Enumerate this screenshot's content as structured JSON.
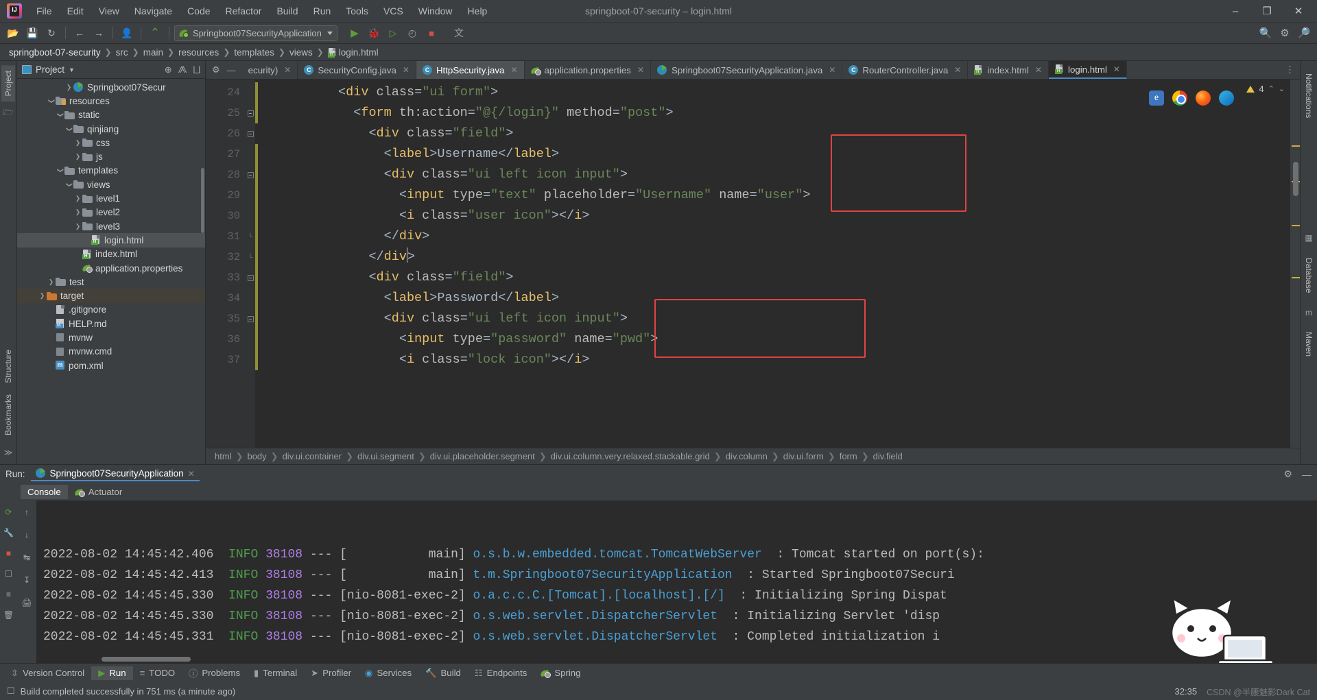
{
  "window": {
    "title": "springboot-07-security – login.html",
    "minimize": "–",
    "maximize": "❐",
    "close": "✕"
  },
  "menu": [
    {
      "label": "File"
    },
    {
      "label": "Edit"
    },
    {
      "label": "View"
    },
    {
      "label": "Navigate"
    },
    {
      "label": "Code"
    },
    {
      "label": "Refactor"
    },
    {
      "label": "Build"
    },
    {
      "label": "Run"
    },
    {
      "label": "Tools"
    },
    {
      "label": "VCS"
    },
    {
      "label": "Window"
    },
    {
      "label": "Help"
    }
  ],
  "toolbar": {
    "open_icon": "📂",
    "save_icon": "💾",
    "sync_icon": "↻",
    "back_icon": "←",
    "forward_icon": "→",
    "profile_icon": "👤",
    "updates_icon": "⌃",
    "run_config": "Springboot07SecurityApplication",
    "run_icon": "▶",
    "debug_icon": "🐞",
    "run_coverage_icon": "▷",
    "profiler_icon": "◴",
    "stop_icon": "■",
    "translate_icon": "文",
    "search_icon": "🔍",
    "settings_icon": "⚙",
    "search_everywhere": "🔎"
  },
  "breadcrumb": {
    "items": [
      "springboot-07-security",
      "src",
      "main",
      "resources",
      "templates",
      "views"
    ],
    "file": "login.html"
  },
  "left_rail": {
    "project_tab": "Project",
    "structure_tab": "Structure",
    "bookmarks_tab": "Bookmarks",
    "more": "≫"
  },
  "project_panel": {
    "title": "Project",
    "dropdown_caret": "▼",
    "locate_icon": "⊕",
    "expand_icon": "⨇",
    "collapse_icon": "⨆",
    "settings_icon": "⚙",
    "hide_icon": "—",
    "tree": [
      {
        "label": "Springboot07Secur",
        "indent": 5,
        "arrow": "closed",
        "icon": "spring",
        "selected": false
      },
      {
        "label": "resources",
        "indent": 3,
        "arrow": "open",
        "icon": "folder-res",
        "selected": false
      },
      {
        "label": "static",
        "indent": 4,
        "arrow": "open",
        "icon": "folder",
        "selected": false
      },
      {
        "label": "qinjiang",
        "indent": 5,
        "arrow": "open",
        "icon": "folder",
        "selected": false
      },
      {
        "label": "css",
        "indent": 6,
        "arrow": "closed",
        "icon": "folder",
        "selected": false
      },
      {
        "label": "js",
        "indent": 6,
        "arrow": "closed",
        "icon": "folder",
        "selected": false
      },
      {
        "label": "templates",
        "indent": 4,
        "arrow": "open",
        "icon": "folder",
        "selected": false
      },
      {
        "label": "views",
        "indent": 5,
        "arrow": "open",
        "icon": "folder",
        "selected": false
      },
      {
        "label": "level1",
        "indent": 6,
        "arrow": "closed",
        "icon": "folder",
        "selected": false
      },
      {
        "label": "level2",
        "indent": 6,
        "arrow": "closed",
        "icon": "folder",
        "selected": false
      },
      {
        "label": "level3",
        "indent": 6,
        "arrow": "closed",
        "icon": "folder",
        "selected": false
      },
      {
        "label": "login.html",
        "indent": 7,
        "arrow": "none",
        "icon": "html",
        "selected": true
      },
      {
        "label": "index.html",
        "indent": 6,
        "arrow": "none",
        "icon": "html",
        "selected": false
      },
      {
        "label": "application.properties",
        "indent": 6,
        "arrow": "none",
        "icon": "leaf",
        "selected": false
      },
      {
        "label": "test",
        "indent": 3,
        "arrow": "closed",
        "icon": "folder",
        "selected": false
      },
      {
        "label": "target",
        "indent": 2,
        "arrow": "closed",
        "icon": "folder-orange",
        "selected": false,
        "secondary": true
      },
      {
        "label": ".gitignore",
        "indent": 3,
        "arrow": "none",
        "icon": "gitignore",
        "selected": false
      },
      {
        "label": "HELP.md",
        "indent": 3,
        "arrow": "none",
        "icon": "md",
        "selected": false
      },
      {
        "label": "mvnw",
        "indent": 3,
        "arrow": "none",
        "icon": "sh",
        "selected": false
      },
      {
        "label": "mvnw.cmd",
        "indent": 3,
        "arrow": "none",
        "icon": "sh",
        "selected": false
      },
      {
        "label": "pom.xml",
        "indent": 3,
        "arrow": "none",
        "icon": "maven",
        "selected": false
      }
    ]
  },
  "editor_tabs": [
    {
      "label": "ecurity)",
      "icon": "none",
      "state": "partial"
    },
    {
      "label": "SecurityConfig.java",
      "icon": "class",
      "state": "normal"
    },
    {
      "label": "HttpSecurity.java",
      "icon": "class",
      "state": "active"
    },
    {
      "label": "application.properties",
      "icon": "leaf",
      "state": "normal"
    },
    {
      "label": "Springboot07SecurityApplication.java",
      "icon": "spring",
      "state": "normal"
    },
    {
      "label": "RouterController.java",
      "icon": "class",
      "state": "normal"
    },
    {
      "label": "index.html",
      "icon": "html",
      "state": "normal"
    },
    {
      "label": "login.html",
      "icon": "html",
      "state": "current"
    }
  ],
  "editor": {
    "close_glyph": "✕",
    "inspections": {
      "count": "4",
      "icon": "warning-triangle"
    },
    "up_icon": "⌃",
    "down_icon": "⌄",
    "lines": [
      {
        "num": "24",
        "fold": "none",
        "tokens": [
          {
            "t": "          ",
            "c": "plain"
          },
          {
            "t": "<",
            "c": "brk"
          },
          {
            "t": "div",
            "c": "tag"
          },
          {
            "t": " class",
            "c": "attr"
          },
          {
            "t": "=",
            "c": "brk"
          },
          {
            "t": "\"ui form\"",
            "c": "str"
          },
          {
            "t": ">",
            "c": "brk"
          }
        ]
      },
      {
        "num": "25",
        "fold": "open",
        "tokens": [
          {
            "t": "            ",
            "c": "plain"
          },
          {
            "t": "<",
            "c": "brk"
          },
          {
            "t": "form",
            "c": "tag"
          },
          {
            "t": " th:action",
            "c": "attr"
          },
          {
            "t": "=",
            "c": "brk"
          },
          {
            "t": "\"@{/login}\"",
            "c": "str"
          },
          {
            "t": " method",
            "c": "attr"
          },
          {
            "t": "=",
            "c": "brk"
          },
          {
            "t": "\"post\"",
            "c": "str"
          },
          {
            "t": ">",
            "c": "brk"
          }
        ]
      },
      {
        "num": "26",
        "fold": "open",
        "tokens": [
          {
            "t": "              ",
            "c": "plain"
          },
          {
            "t": "<",
            "c": "brk"
          },
          {
            "t": "div",
            "c": "tag"
          },
          {
            "t": " class",
            "c": "attr"
          },
          {
            "t": "=",
            "c": "brk"
          },
          {
            "t": "\"field\"",
            "c": "str"
          },
          {
            "t": ">",
            "c": "brk"
          }
        ]
      },
      {
        "num": "27",
        "fold": "none",
        "tokens": [
          {
            "t": "                ",
            "c": "plain"
          },
          {
            "t": "<",
            "c": "brk"
          },
          {
            "t": "label",
            "c": "tag"
          },
          {
            "t": ">",
            "c": "brk"
          },
          {
            "t": "Username",
            "c": "plain"
          },
          {
            "t": "</",
            "c": "brk"
          },
          {
            "t": "label",
            "c": "tag"
          },
          {
            "t": ">",
            "c": "brk"
          }
        ]
      },
      {
        "num": "28",
        "fold": "open",
        "tokens": [
          {
            "t": "                ",
            "c": "plain"
          },
          {
            "t": "<",
            "c": "brk"
          },
          {
            "t": "div",
            "c": "tag"
          },
          {
            "t": " class",
            "c": "attr"
          },
          {
            "t": "=",
            "c": "brk"
          },
          {
            "t": "\"ui left icon input\"",
            "c": "str"
          },
          {
            "t": ">",
            "c": "brk"
          }
        ]
      },
      {
        "num": "29",
        "fold": "none",
        "tokens": [
          {
            "t": "                  ",
            "c": "plain"
          },
          {
            "t": "<",
            "c": "brk"
          },
          {
            "t": "input",
            "c": "tag"
          },
          {
            "t": " type",
            "c": "attr"
          },
          {
            "t": "=",
            "c": "brk"
          },
          {
            "t": "\"text\"",
            "c": "str"
          },
          {
            "t": " placeholder",
            "c": "attr"
          },
          {
            "t": "=",
            "c": "brk"
          },
          {
            "t": "\"Username\"",
            "c": "str"
          },
          {
            "t": " name",
            "c": "attr"
          },
          {
            "t": "=",
            "c": "brk"
          },
          {
            "t": "\"user\"",
            "c": "str"
          },
          {
            "t": ">",
            "c": "brk"
          }
        ]
      },
      {
        "num": "30",
        "fold": "none",
        "tokens": [
          {
            "t": "                  ",
            "c": "plain"
          },
          {
            "t": "<",
            "c": "brk"
          },
          {
            "t": "i",
            "c": "tag"
          },
          {
            "t": " class",
            "c": "attr"
          },
          {
            "t": "=",
            "c": "brk"
          },
          {
            "t": "\"user icon\"",
            "c": "str"
          },
          {
            "t": ">",
            "c": "brk"
          },
          {
            "t": "</",
            "c": "brk"
          },
          {
            "t": "i",
            "c": "tag"
          },
          {
            "t": ">",
            "c": "brk"
          }
        ]
      },
      {
        "num": "31",
        "fold": "close",
        "tokens": [
          {
            "t": "                ",
            "c": "plain"
          },
          {
            "t": "</",
            "c": "brk"
          },
          {
            "t": "div",
            "c": "tag"
          },
          {
            "t": ">",
            "c": "brk"
          }
        ]
      },
      {
        "num": "32",
        "fold": "close",
        "tokens": [
          {
            "t": "              ",
            "c": "plain"
          },
          {
            "t": "</",
            "c": "brk"
          },
          {
            "t": "div",
            "c": "tag"
          },
          {
            "t": ">",
            "c": "brk"
          }
        ]
      },
      {
        "num": "33",
        "fold": "open",
        "tokens": [
          {
            "t": "              ",
            "c": "plain"
          },
          {
            "t": "<",
            "c": "brk"
          },
          {
            "t": "div",
            "c": "tag"
          },
          {
            "t": " class",
            "c": "attr"
          },
          {
            "t": "=",
            "c": "brk"
          },
          {
            "t": "\"field\"",
            "c": "str"
          },
          {
            "t": ">",
            "c": "brk"
          }
        ]
      },
      {
        "num": "34",
        "fold": "none",
        "tokens": [
          {
            "t": "                ",
            "c": "plain"
          },
          {
            "t": "<",
            "c": "brk"
          },
          {
            "t": "label",
            "c": "tag"
          },
          {
            "t": ">",
            "c": "brk"
          },
          {
            "t": "Password",
            "c": "plain"
          },
          {
            "t": "</",
            "c": "brk"
          },
          {
            "t": "label",
            "c": "tag"
          },
          {
            "t": ">",
            "c": "brk"
          }
        ]
      },
      {
        "num": "35",
        "fold": "open",
        "tokens": [
          {
            "t": "                ",
            "c": "plain"
          },
          {
            "t": "<",
            "c": "brk"
          },
          {
            "t": "div",
            "c": "tag"
          },
          {
            "t": " class",
            "c": "attr"
          },
          {
            "t": "=",
            "c": "brk"
          },
          {
            "t": "\"ui left icon input\"",
            "c": "str"
          },
          {
            "t": ">",
            "c": "brk"
          }
        ]
      },
      {
        "num": "36",
        "fold": "none",
        "tokens": [
          {
            "t": "                  ",
            "c": "plain"
          },
          {
            "t": "<",
            "c": "brk"
          },
          {
            "t": "input",
            "c": "tag"
          },
          {
            "t": " type",
            "c": "attr"
          },
          {
            "t": "=",
            "c": "brk"
          },
          {
            "t": "\"password\"",
            "c": "str"
          },
          {
            "t": " name",
            "c": "attr"
          },
          {
            "t": "=",
            "c": "brk"
          },
          {
            "t": "\"pwd\"",
            "c": "str"
          },
          {
            "t": ">",
            "c": "brk"
          }
        ]
      },
      {
        "num": "37",
        "fold": "none",
        "tokens": [
          {
            "t": "                  ",
            "c": "plain"
          },
          {
            "t": "<",
            "c": "brk"
          },
          {
            "t": "i",
            "c": "tag"
          },
          {
            "t": " class",
            "c": "attr"
          },
          {
            "t": "=",
            "c": "brk"
          },
          {
            "t": "\"lock icon\"",
            "c": "str"
          },
          {
            "t": ">",
            "c": "brk"
          },
          {
            "t": "</",
            "c": "brk"
          },
          {
            "t": "i",
            "c": "tag"
          },
          {
            "t": ">",
            "c": "brk"
          }
        ]
      }
    ],
    "browser_icons": [
      "ie-icon",
      "chrome-icon",
      "firefox-icon",
      "edge-icon"
    ],
    "highlight_color": "#e04343"
  },
  "editor_breadcrumb": [
    "html",
    "body",
    "div.ui.container",
    "div.ui.segment",
    "div.ui.placeholder.segment",
    "div.ui.column.very.relaxed.stackable.grid",
    "div.column",
    "div.ui.form",
    "form",
    "div.field"
  ],
  "run_window": {
    "label": "Run:",
    "config_name": "Springboot07SecurityApplication",
    "close_icon": "✕",
    "settings_icon": "⚙",
    "hide_icon": "—",
    "tabs": [
      {
        "label": "Console",
        "selected": true
      },
      {
        "label": "Actuator",
        "selected": false
      }
    ],
    "rail_icons": [
      "rerun-icon",
      "wrench-icon",
      "stop-icon",
      "camera-icon",
      "trash-icon",
      "scroll-up-icon",
      "scroll-down-icon",
      "soft-wrap-icon",
      "print-icon",
      "export-icon"
    ],
    "console_lines": [
      {
        "ts": "2022-08-02 14:45:42.406",
        "level": "INFO",
        "pid": "38108",
        "dash": "---",
        "thread": "[           main]",
        "logger": "o.s.b.w.embedded.tomcat.TomcatWebServer",
        "sep": ":",
        "msg": "Tomcat started on port(s):"
      },
      {
        "ts": "2022-08-02 14:45:42.413",
        "level": "INFO",
        "pid": "38108",
        "dash": "---",
        "thread": "[           main]",
        "logger": "t.m.Springboot07SecurityApplication",
        "sep": ":",
        "msg": "Started Springboot07Securi"
      },
      {
        "ts": "2022-08-02 14:45:45.330",
        "level": "INFO",
        "pid": "38108",
        "dash": "---",
        "thread": "[nio-8081-exec-2]",
        "logger": "o.a.c.c.C.[Tomcat].[localhost].[/]",
        "sep": ":",
        "msg": "Initializing Spring Dispat"
      },
      {
        "ts": "2022-08-02 14:45:45.330",
        "level": "INFO",
        "pid": "38108",
        "dash": "---",
        "thread": "[nio-8081-exec-2]",
        "logger": "o.s.web.servlet.DispatcherServlet",
        "sep": ":",
        "msg": "Initializing Servlet 'disp"
      },
      {
        "ts": "2022-08-02 14:45:45.331",
        "level": "INFO",
        "pid": "38108",
        "dash": "---",
        "thread": "[nio-8081-exec-2]",
        "logger": "o.s.web.servlet.DispatcherServlet",
        "sep": ":",
        "msg": "Completed initialization i"
      }
    ]
  },
  "bottom_tools": [
    {
      "label": "Version Control",
      "icon": "branch-icon",
      "selected": false
    },
    {
      "label": "Run",
      "icon": "play-icon",
      "selected": true
    },
    {
      "label": "TODO",
      "icon": "list-icon",
      "selected": false
    },
    {
      "label": "Problems",
      "icon": "warning-icon",
      "selected": false
    },
    {
      "label": "Terminal",
      "icon": "terminal-icon",
      "selected": false
    },
    {
      "label": "Profiler",
      "icon": "gauge-icon",
      "selected": false
    },
    {
      "label": "Services",
      "icon": "services-icon",
      "selected": false
    },
    {
      "label": "Build",
      "icon": "hammer-icon",
      "selected": false
    },
    {
      "label": "Endpoints",
      "icon": "endpoints-icon",
      "selected": false
    },
    {
      "label": "Spring",
      "icon": "leaf-icon",
      "selected": false
    }
  ],
  "status_bar": {
    "message": "Build completed successfully in 751 ms (a minute ago)",
    "position": "32:35",
    "watermark": "CSDN @半腰魅影Dark Cat"
  },
  "right_rail": {
    "notifications": "Notifications",
    "database": "Database",
    "maven": "Maven"
  }
}
